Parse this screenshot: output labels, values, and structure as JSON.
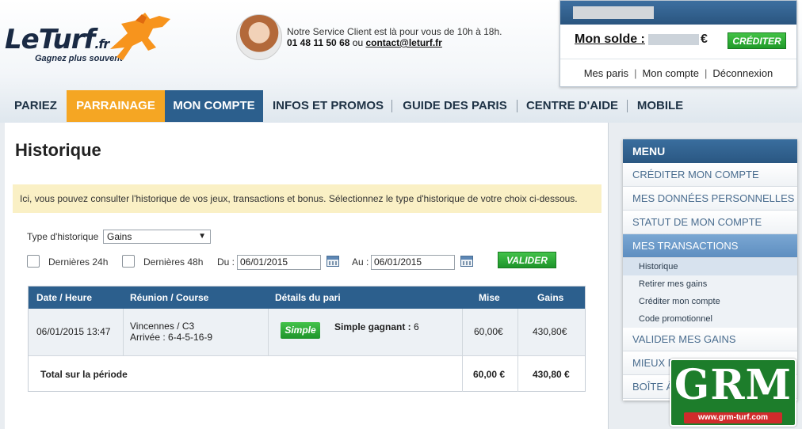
{
  "header": {
    "logo": {
      "brand": "LeTurf",
      "suffix": ".fr",
      "tagline": "Gagnez plus souvent"
    },
    "service": {
      "line1": "Notre Service Client est là pour vous de 10h à 18h.",
      "phone": "01 48 11 50 68",
      "or": "ou",
      "email": "contact@leturf.fr"
    },
    "account": {
      "solde_label": "Mon solde :",
      "currency": "€",
      "crediter": "CRÉDITER",
      "links": [
        "Mes paris",
        "Mon compte",
        "Déconnexion"
      ],
      "separator": "|"
    }
  },
  "nav": [
    "PARIEZ",
    "PARRAINAGE",
    "MON COMPTE",
    "INFOS ET PROMOS",
    "GUIDE DES PARIS",
    "CENTRE D'AIDE",
    "MOBILE"
  ],
  "main": {
    "title": "Historique",
    "notice": "Ici, vous pouvez consulter l'historique de vos jeux, transactions et bonus. Sélectionnez le type d'historique de votre choix ci-dessous.",
    "filters": {
      "type_label": "Type d'historique",
      "type_value": "Gains",
      "last24": "Dernières 24h",
      "last48": "Dernières 48h",
      "du_label": "Du :",
      "du_value": "06/01/2015",
      "au_label": "Au :",
      "au_value": "06/01/2015",
      "valider": "VALIDER"
    },
    "table": {
      "headers": [
        "Date / Heure",
        "Réunion / Course",
        "Détails du pari",
        "Mise",
        "Gains"
      ],
      "row": {
        "date": "06/01/2015 13:47",
        "reunion": "Vincennes / C3",
        "arrivee": "Arrivée : 6-4-5-16-9",
        "badge": "Simple",
        "detail_label": "Simple gagnant :",
        "detail_value": "6",
        "mise": "60,00€",
        "gains": "430,80€"
      },
      "total": {
        "label": "Total sur la période",
        "mise": "60,00 €",
        "gains": "430,80 €"
      }
    }
  },
  "menu": {
    "title": "MENU",
    "items": [
      "CRÉDITER MON COMPTE",
      "MES DONNÉES PERSONNELLES",
      "STATUT DE MON COMPTE",
      "MES TRANSACTIONS"
    ],
    "subitems": [
      "Historique",
      "Retirer mes gains",
      "Créditer mon compte",
      "Code promotionnel"
    ],
    "after": [
      "VALIDER MES GAINS",
      "MIEUX P",
      "BOÎTE À"
    ]
  },
  "watermark": {
    "letters": "GRM",
    "url": "www.grm-turf.com"
  }
}
